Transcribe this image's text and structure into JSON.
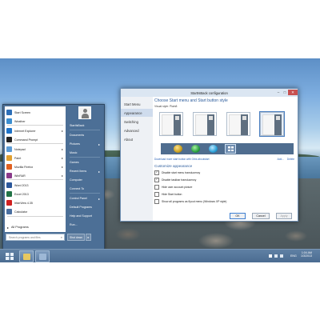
{
  "start_menu": {
    "left_items": [
      {
        "label": "Start Screen",
        "color": "#2d6fb8",
        "arrow": false
      },
      {
        "label": "Weather",
        "color": "#3b8ed0",
        "arrow": false
      },
      {
        "label": "Internet Explorer",
        "color": "#1e73c8",
        "arrow": true
      },
      {
        "label": "Command Prompt",
        "color": "#222222",
        "arrow": false
      },
      {
        "label": "Notepad",
        "color": "#5b9bd5",
        "arrow": true
      },
      {
        "label": "Paint",
        "color": "#e0a030",
        "arrow": true
      },
      {
        "label": "Mozilla Firefox",
        "color": "#e06020",
        "arrow": true
      },
      {
        "label": "WinRAR",
        "color": "#8a3a8a",
        "arrow": true
      },
      {
        "label": "Word 2013",
        "color": "#2b579a",
        "arrow": false
      },
      {
        "label": "Excel 2013",
        "color": "#217346",
        "arrow": false
      },
      {
        "label": "IrfanView 4.35",
        "color": "#d02020",
        "arrow": false
      },
      {
        "label": "Calculator",
        "color": "#4a6fa0",
        "arrow": false
      }
    ],
    "all_programs": "All Programs",
    "search_placeholder": "Search programs and files",
    "user_name": "StartIsBack",
    "right_items": [
      {
        "label": "StartIsBack",
        "arrow": false
      },
      {
        "label": "Documents",
        "arrow": false
      },
      {
        "label": "Pictures",
        "arrow": true
      },
      {
        "label": "Music",
        "arrow": false
      },
      {
        "label": "Games",
        "arrow": false
      },
      {
        "label": "Recent Items",
        "arrow": true
      },
      {
        "label": "Computer",
        "arrow": false
      },
      {
        "label": "Connect To",
        "arrow": false
      },
      {
        "label": "Control Panel",
        "arrow": true
      },
      {
        "label": "Default Programs",
        "arrow": false
      },
      {
        "label": "Help and Support",
        "arrow": false
      },
      {
        "label": "Run...",
        "arrow": false
      }
    ],
    "shutdown_label": "Shut down",
    "shutdown_arrow": "▸"
  },
  "taskbar": {
    "buttons": [
      {
        "name": "explorer",
        "color": "#e8c860"
      },
      {
        "name": "config",
        "color": "#9db8d6"
      }
    ],
    "tray_lang": "ENG",
    "time": "1:04 AM",
    "date": "1/3/2013"
  },
  "config_window": {
    "title": "StartIsBack configuration",
    "controls": {
      "minimize": "–",
      "maximize": "□",
      "close": "✕"
    },
    "nav": [
      "Start Menu",
      "Appearance",
      "Switching",
      "Advanced",
      "About"
    ],
    "active_nav": 1,
    "heading": "Choose Start menu and Start button style",
    "visual_style_label": "Visual style:",
    "visual_style_value": "Plain8",
    "styles_count_selected": 4,
    "download_link": "Download more start button with Orbs aboutstart",
    "add_link": "Add...",
    "delete_link": "Delete",
    "customize_heading": "Customize appearance",
    "options": [
      {
        "label": "Disable start menu translucency",
        "checked": true
      },
      {
        "label": "Disable taskbar translucency",
        "checked": true
      },
      {
        "label": "Hide user account picture",
        "checked": false
      },
      {
        "label": "Hide Start button",
        "checked": false
      },
      {
        "label": "Show all programs as flyout menu (Windows XP style)",
        "checked": false
      }
    ],
    "ok": "OK",
    "cancel": "Cancel",
    "apply": "Apply"
  },
  "colors": {
    "start_menu_bg": "#4c6f96",
    "accent_link": "#2a62b8",
    "heading": "#2c5c9c"
  }
}
